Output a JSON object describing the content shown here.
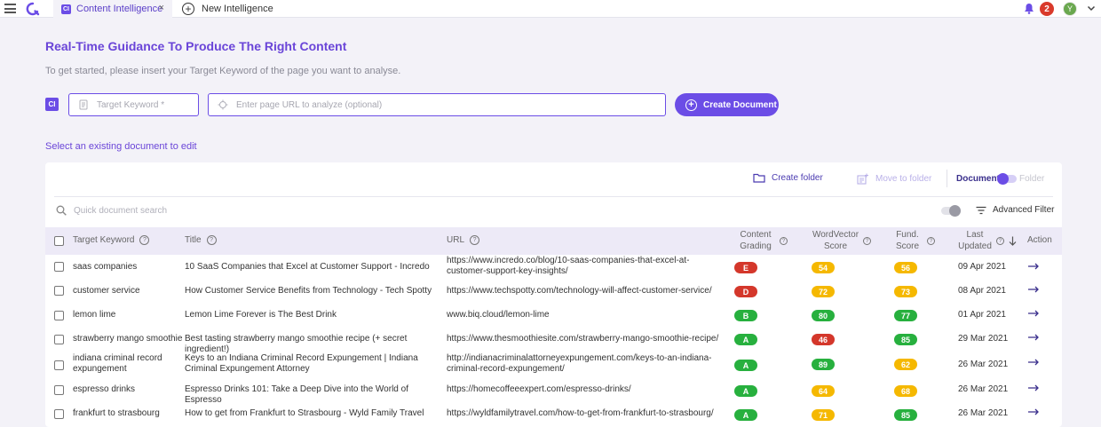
{
  "topbar": {
    "tab_badge": "CI",
    "tab_active_label": "Content Intelligence",
    "tab_close": "×",
    "tab_new_label": "New Intelligence",
    "notification_count": "2",
    "avatar_initial": "Y"
  },
  "header": {
    "title": "Real-Time Guidance To Produce The Right Content",
    "subtitle": "To get started, please insert your Target Keyword of the page you want to analyse."
  },
  "form": {
    "badge": "CI",
    "keyword_placeholder": "Target Keyword *",
    "url_placeholder": "Enter page URL to analyze (optional)",
    "create_label": "Create Document"
  },
  "select_existing": "Select an existing document to edit",
  "toolbar": {
    "create_folder": "Create folder",
    "move_to_folder": "Move to folder",
    "document": "Document",
    "folder": "Folder",
    "search_placeholder": "Quick document search",
    "advanced_filter": "Advanced Filter"
  },
  "table": {
    "headers": {
      "keyword": "Target Keyword",
      "title": "Title",
      "url": "URL",
      "grading_1": "Content",
      "grading_2": "Grading",
      "wv_1": "WordVector",
      "wv_2": "Score",
      "fund_1": "Fund.",
      "fund_2": "Score",
      "updated_1": "Last",
      "updated_2": "Updated",
      "action": "Action"
    },
    "rows": [
      {
        "keyword": "saas companies",
        "title": "10 SaaS Companies that Excel at Customer Support - Incredo",
        "url": "https://www.incredo.co/blog/10-saas-companies-that-excel-at-customer-support-key-insights/",
        "grade": "E",
        "grade_color": "red",
        "wv": "54",
        "wv_color": "yellow",
        "fund": "56",
        "fund_color": "yellow",
        "updated": "09 Apr 2021"
      },
      {
        "keyword": "customer service",
        "title": "How Customer Service Benefits from Technology - Tech Spotty",
        "url": "https://www.techspotty.com/technology-will-affect-customer-service/",
        "grade": "D",
        "grade_color": "red",
        "wv": "72",
        "wv_color": "yellow",
        "fund": "73",
        "fund_color": "yellow",
        "updated": "08 Apr 2021"
      },
      {
        "keyword": "lemon lime",
        "title": "Lemon Lime Forever is The Best Drink",
        "url": "www.biq.cloud/lemon-lime",
        "grade": "B",
        "grade_color": "green",
        "wv": "80",
        "wv_color": "green",
        "fund": "77",
        "fund_color": "green",
        "updated": "01 Apr 2021"
      },
      {
        "keyword": "strawberry mango smoothie",
        "title": "Best tasting strawberry mango smoothie recipe (+ secret ingredient!)",
        "url": "https://www.thesmoothiesite.com/strawberry-mango-smoothie-recipe/",
        "grade": "A",
        "grade_color": "green",
        "wv": "46",
        "wv_color": "red",
        "fund": "85",
        "fund_color": "green",
        "updated": "29 Mar 2021"
      },
      {
        "keyword": "indiana criminal record expungement",
        "title": "Keys to an Indiana Criminal Record Expungement | Indiana Criminal Expungement Attorney",
        "url": "http://indianacriminalattorneyexpungement.com/keys-to-an-indiana-criminal-record-expungement/",
        "grade": "A",
        "grade_color": "green",
        "wv": "89",
        "wv_color": "green",
        "fund": "62",
        "fund_color": "yellow",
        "updated": "26 Mar 2021"
      },
      {
        "keyword": "espresso drinks",
        "title": "Espresso Drinks 101: Take a Deep Dive into the World of Espresso",
        "url": "https://homecoffeeexpert.com/espresso-drinks/",
        "grade": "A",
        "grade_color": "green",
        "wv": "64",
        "wv_color": "yellow",
        "fund": "68",
        "fund_color": "yellow",
        "updated": "26 Mar 2021"
      },
      {
        "keyword": "frankfurt to strasbourg",
        "title": "How to get from Frankfurt to Strasbourg - Wyld Family Travel",
        "url": "https://wyldfamilytravel.com/how-to-get-from-frankfurt-to-strasbourg/",
        "grade": "A",
        "grade_color": "green",
        "wv": "71",
        "wv_color": "yellow",
        "fund": "85",
        "fund_color": "green",
        "updated": "26 Mar 2021"
      }
    ]
  },
  "colors": {
    "accent": "#6b4de6",
    "green": "#27b03e",
    "red": "#d4372b",
    "yellow": "#f5b800"
  }
}
